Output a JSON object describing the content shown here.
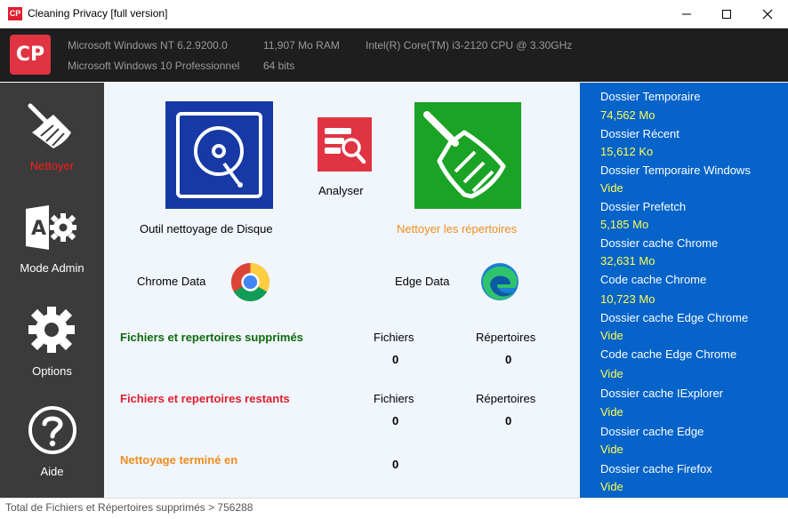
{
  "window": {
    "title": "Cleaning Privacy [full version]",
    "app_icon_text": "CP",
    "logo_text": "CP"
  },
  "system_info": {
    "os_nt": "Microsoft Windows NT 6.2.9200.0",
    "ram": "11,907 Mo RAM",
    "cpu": "Intel(R) Core(TM) i3-2120 CPU @ 3.30GHz",
    "os_name": "Microsoft Windows 10 Professionnel",
    "bits": "64 bits"
  },
  "sidebar": {
    "items": [
      {
        "label": "Nettoyer",
        "icon": "broom-icon",
        "active": true
      },
      {
        "label": "Mode Admin",
        "icon": "admin-gear-icon"
      },
      {
        "label": "Options",
        "icon": "gear-icon"
      },
      {
        "label": "Aide",
        "icon": "help-icon"
      }
    ]
  },
  "main": {
    "disk_tool_label": "Outil nettoyage de Disque",
    "analyze_label": "Analyser",
    "clean_dirs_label": "Nettoyer les répertoires",
    "chrome_label": "Chrome Data",
    "edge_label": "Edge Data",
    "deleted": {
      "title": "Fichiers et repertoires supprimés",
      "files_header": "Fichiers",
      "dirs_header": "Répertoires",
      "files_value": "0",
      "dirs_value": "0"
    },
    "remaining": {
      "title": "Fichiers et repertoires restants",
      "files_header": "Fichiers",
      "dirs_header": "Répertoires",
      "files_value": "0",
      "dirs_value": "0"
    },
    "finished": {
      "title": "Nettoyage terminé en",
      "value": "0"
    }
  },
  "right_panel": {
    "items": [
      {
        "label": "Dossier Temporaire",
        "value": "74,562 Mo"
      },
      {
        "label": "Dossier Récent",
        "value": "15,612 Ko"
      },
      {
        "label": "Dossier Temporaire Windows",
        "value": "Vide"
      },
      {
        "label": "Dossier Prefetch",
        "value": "5,185 Mo"
      },
      {
        "label": "Dossier cache Chrome",
        "value": "32,631 Mo"
      },
      {
        "label": "Code cache Chrome",
        "value": "10,723 Mo"
      },
      {
        "label": "Dossier cache Edge Chrome",
        "value": "Vide"
      },
      {
        "label": "Code cache Edge Chrome",
        "value": "Vide"
      },
      {
        "label": "Dossier cache IExplorer",
        "value": "Vide"
      },
      {
        "label": "Dossier cache Edge",
        "value": "Vide"
      },
      {
        "label": "Dossier cache Firefox",
        "value": "Vide"
      }
    ]
  },
  "status": {
    "text": "Total de Fichiers et Répertoires supprimés > 756288"
  },
  "colors": {
    "accent_red": "#e01e2e",
    "panel_blue": "#0563c9",
    "value_yellow": "#ffff50",
    "green": "#1aa325",
    "orange": "#f08c1e"
  }
}
